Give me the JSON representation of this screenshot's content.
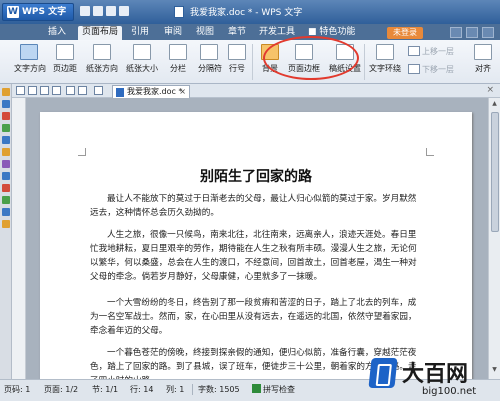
{
  "app": {
    "name": "WPS 文字",
    "window_title": "我爱我家.doc * - WPS 文字"
  },
  "menu": {
    "items": [
      "插入",
      "页面布局",
      "引用",
      "审阅",
      "视图",
      "章节",
      "开发工具"
    ],
    "active": "页面布局",
    "special": "特色功能",
    "login": "未登录"
  },
  "ribbon": {
    "text_direction": "文字方向",
    "margins": "页边距",
    "orientation": "纸张方向",
    "paper_size": "纸张大小",
    "columns": "分栏",
    "breaks": "分隔符",
    "line_numbers": "行号",
    "background": "背景",
    "page_border": "页面边框",
    "manuscript": "稿纸设置",
    "text_wrap": "文字环绕",
    "bring_forward": "上移一层",
    "send_backward": "下移一层",
    "align": "对齐"
  },
  "tab": {
    "doc_name": "我爱我家.doc *"
  },
  "document": {
    "title": "别陌生了回家的路",
    "paragraphs": [
      "最让人不能放下的莫过于日渐老去的父母，最让人归心似箭的莫过于家。岁月默然远去，这种情怀总会历久劲拗的。",
      "人生之旅，很像一只候鸟，南来北往，北往南来，远离亲人，浪迹天涯处。春日里忙我地耕耘，夏日里艰辛的劳作，期待能在人生之秋有所丰硕。漫漫人生之旅，无论何以繁华，何以桑盛，总会在人生的渡口，不经意间，回首故土，回首老屋，渴生一种对父母的牵念。倘若岁月静好，父母康健，心里就多了一抹暖。",
      "一个大雪纷纷的冬日，终告别了那一段贫瘠和苦涩的日子，踏上了北去的列车，成为一名空军战士。然而，家，在心田里从没有远去，在遥远的北国，依然守望着家园，牵念着年迈的父母。",
      "一个暮色苍茫的傍晚，终接到探亲假的通知，便归心似箭，准备行囊，穿越茫茫夜色，踏上了回家的路。到了县城，误了班车，便徒步三十公里，朝着家的方向赶路。走了四小时的山路……"
    ]
  },
  "status": {
    "page": "页码: 1",
    "pages": "页面: 1/2",
    "section": "节: 1/1",
    "row": "行: 14",
    "col": "列: 1",
    "words": "字数: 1505",
    "spellcheck": "拼写检查"
  },
  "watermark": {
    "brand": "大百网",
    "url": "big100.net"
  }
}
